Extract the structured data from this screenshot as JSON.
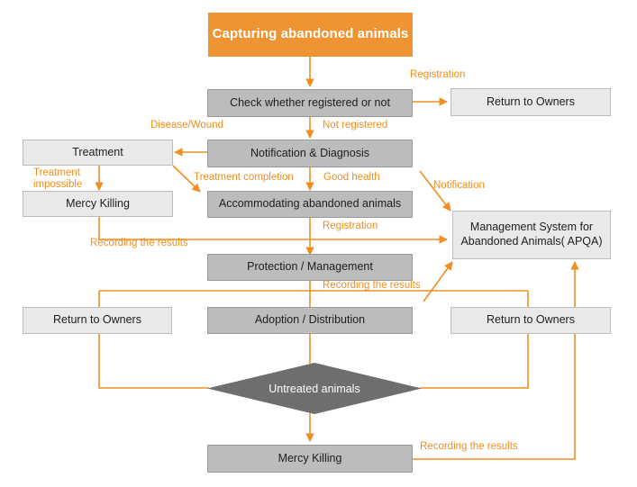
{
  "diagram": {
    "title": "Abandoned animals handling process flowchart",
    "colors": {
      "accent_orange": "#ef9432",
      "connector_orange": "#ef8f20",
      "dark_box": "#bcbcbc",
      "light_box": "#e9e9e9",
      "diamond": "#6e6e6e",
      "text_dark": "#1d1d1d",
      "text_light": "#ffffff"
    },
    "nodes": {
      "capturing": "Capturing abandoned animals",
      "check_registered": "Check whether registered or not",
      "return_owners_top": "Return to Owners",
      "notification_diagnosis": "Notification & Diagnosis",
      "treatment": "Treatment",
      "mercy_killing_left": "Mercy Killing",
      "accommodating": "Accommodating abandoned animals",
      "apqa_line1": "Management System for",
      "apqa_line2": "Abandoned Animals( APQA)",
      "protection_management": "Protection / Management",
      "return_owners_left": "Return to Owners",
      "adoption_distribution": "Adoption / Distribution",
      "return_owners_right": "Return to Owners",
      "untreated_animals": "Untreated animals",
      "mercy_killing_bottom": "Mercy Killing"
    },
    "edge_labels": {
      "registration_top": "Registration",
      "disease_wound": "Disease/Wound",
      "not_registered": "Not registered",
      "treatment_impossible_l1": "Treatment",
      "treatment_impossible_l2": "impossible",
      "treatment_completion": "Treatment completion",
      "good_health": "Good health",
      "notification": "Notification",
      "recording_results_left": "Recording the results",
      "registration_mid": "Registration",
      "recording_results_mid": "Recording the results",
      "recording_results_bottom": "Recording the results"
    }
  }
}
